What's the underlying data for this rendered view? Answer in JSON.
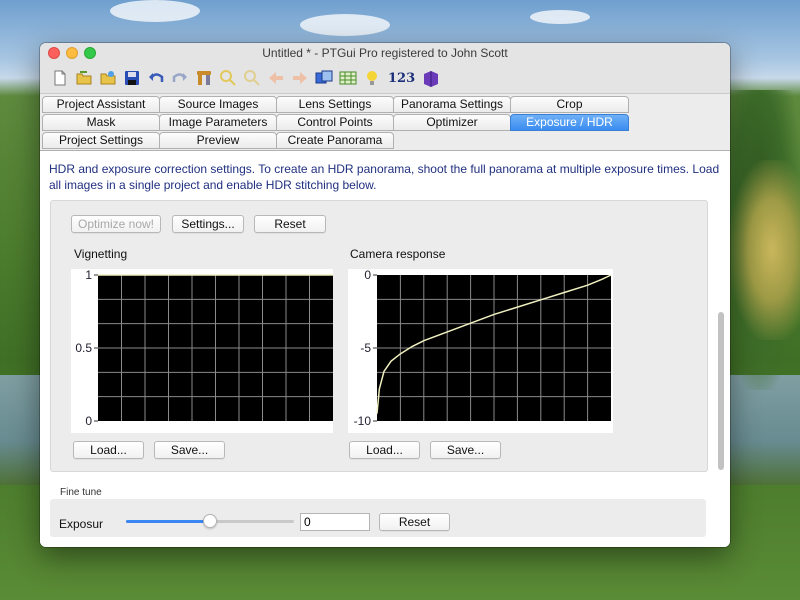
{
  "window": {
    "title": "Untitled * - PTGui Pro registered to John Scott"
  },
  "toolbar": {
    "items": [
      {
        "name": "new-file-icon"
      },
      {
        "name": "open-folder-icon"
      },
      {
        "name": "open-recent-icon"
      },
      {
        "name": "save-icon"
      },
      {
        "name": "undo-icon"
      },
      {
        "name": "redo-icon"
      },
      {
        "name": "tools-icon"
      },
      {
        "name": "zoom-in-icon"
      },
      {
        "name": "zoom-out-icon"
      },
      {
        "name": "arrow-left-icon"
      },
      {
        "name": "arrow-right-icon"
      },
      {
        "name": "panorama-editor-icon"
      },
      {
        "name": "table-icon"
      },
      {
        "name": "lightbulb-icon"
      },
      {
        "name": "numbers-icon",
        "text": "123"
      },
      {
        "name": "book-icon"
      }
    ]
  },
  "tabs": {
    "row1": [
      "Project Assistant",
      "Source Images",
      "Lens Settings",
      "Panorama Settings",
      "Crop"
    ],
    "row2": [
      "Mask",
      "Image Parameters",
      "Control Points",
      "Optimizer",
      "Exposure / HDR"
    ],
    "row3": [
      "Project Settings",
      "Preview",
      "Create Panorama"
    ],
    "active": "Exposure / HDR"
  },
  "content": {
    "description": "HDR and exposure correction settings. To create an HDR panorama, shoot the full panorama at multiple exposure times. Load all images in a single project and enable HDR stitching below."
  },
  "buttons": {
    "optimize": "Optimize now!",
    "settings": "Settings...",
    "reset": "Reset",
    "load": "Load...",
    "save": "Save...",
    "reset_finetune": "Reset"
  },
  "vignetting": {
    "title": "Vignetting",
    "y_ticks": [
      "1",
      "0.5",
      "0"
    ]
  },
  "camera_response": {
    "title": "Camera response",
    "y_ticks": [
      "0",
      "-5",
      "-10"
    ]
  },
  "chart_data": [
    {
      "type": "line",
      "title": "Vignetting",
      "xlabel": "",
      "ylabel": "",
      "ylim": [
        0,
        1.0
      ],
      "x": [
        0,
        0.25,
        0.5,
        0.75,
        1.0
      ],
      "series": [
        {
          "values": [
            1,
            1,
            1,
            1,
            1
          ]
        }
      ],
      "grid": true,
      "colors": {
        "background": "#000000",
        "grid": "#8a8a8a",
        "line": "#f0f0c0"
      }
    },
    {
      "type": "line",
      "title": "Camera response",
      "xlabel": "",
      "ylabel": "",
      "ylim": [
        -10,
        0
      ],
      "x": [
        0.0,
        0.01,
        0.03,
        0.06,
        0.1,
        0.15,
        0.2,
        0.3,
        0.4,
        0.5,
        0.6,
        0.7,
        0.8,
        0.9,
        0.96,
        1.0
      ],
      "series": [
        {
          "values": [
            -9.5,
            -7.8,
            -6.6,
            -5.9,
            -5.4,
            -4.9,
            -4.5,
            -3.9,
            -3.3,
            -2.7,
            -2.2,
            -1.7,
            -1.2,
            -0.7,
            -0.3,
            0
          ]
        }
      ],
      "grid": true,
      "colors": {
        "background": "#000000",
        "grid": "#8a8a8a",
        "line": "#f0f0c0"
      }
    }
  ],
  "fine_tune": {
    "label": "Fine tune",
    "exposure_label": "Exposur",
    "exposure_value": "0",
    "slider_level": 0.5
  }
}
